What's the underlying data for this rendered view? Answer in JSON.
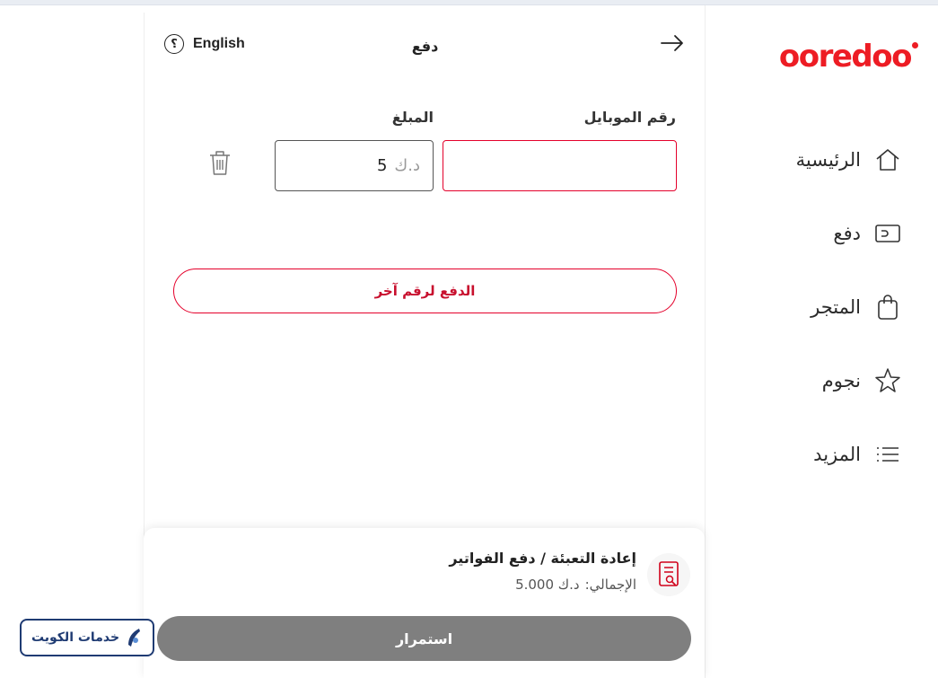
{
  "brand": {
    "logo_text": "ooredoo",
    "color": "#ed1c24"
  },
  "sidebar": {
    "items": [
      {
        "label": "الرئيسية",
        "icon": "home-icon"
      },
      {
        "label": "دفع",
        "icon": "wallet-icon"
      },
      {
        "label": "المتجر",
        "icon": "shopping-bag-icon"
      },
      {
        "label": "نجوم",
        "icon": "star-icon"
      },
      {
        "label": "المزيد",
        "icon": "menu-icon"
      }
    ]
  },
  "header": {
    "title": "دفع",
    "language_label": "English",
    "language_icon_glyph": "؟"
  },
  "form": {
    "mobile_label": "رقم الموبايل",
    "mobile_value": "",
    "amount_label": "المبلغ",
    "amount_currency": "د.ك",
    "amount_value": "5",
    "add_number_label": "الدفع لرقم آخر"
  },
  "summary": {
    "title": "إعادة التعبئة / دفع الفواتير",
    "total_label": "الإجمالي:",
    "total_value": "د.ك 5.000",
    "continue_label": "استمرار"
  },
  "watermark": {
    "text": "خدمات الكويت"
  }
}
